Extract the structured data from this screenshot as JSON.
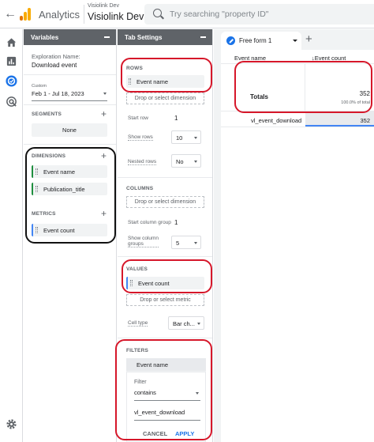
{
  "topbar": {
    "product": "Analytics",
    "account_small": "Visiolink Dev",
    "account_name": "Visiolink Dev",
    "search_placeholder": "Try searching \"property ID\""
  },
  "leftnav": {
    "icons": [
      "home-icon",
      "reports-icon",
      "explore-icon",
      "advertising-icon",
      "settings-icon"
    ]
  },
  "variables": {
    "title": "Variables",
    "exploration_label": "Exploration Name:",
    "exploration_name": "Download event",
    "date_custom": "Custom",
    "date_range": "Feb 1 - Jul 18, 2023",
    "segments_label": "SEGMENTS",
    "segments_none": "None",
    "dimensions_label": "DIMENSIONS",
    "dimensions": [
      "Event name",
      "Publication_title"
    ],
    "metrics_label": "METRICS",
    "metrics": [
      "Event count"
    ]
  },
  "tab_settings": {
    "title": "Tab Settings",
    "rows_label": "ROWS",
    "rows_chip": "Event name",
    "drop_dimension": "Drop or select dimension",
    "start_row_label": "Start row",
    "start_row": "1",
    "show_rows_label": "Show rows",
    "show_rows": "10",
    "nested_rows_label": "Nested rows",
    "nested_rows": "No",
    "columns_label": "COLUMNS",
    "start_col_group_label": "Start column group",
    "start_col_group": "1",
    "show_col_groups_label_1": "Show column",
    "show_col_groups_label_2": "groups",
    "show_col_groups": "5",
    "values_label": "VALUES",
    "values_chip": "Event count",
    "drop_metric": "Drop or select metric",
    "cell_type_label": "Cell type",
    "cell_type": "Bar ch...",
    "filters_label": "FILTERS",
    "filter_chip": "Event name",
    "filter_label": "Filter",
    "filter_match": "contains",
    "filter_value": "vl_event_download",
    "cancel": "CANCEL",
    "apply": "APPLY"
  },
  "canvas": {
    "tab_name": "Free form 1",
    "col_dimension": "Event name",
    "col_metric": "↓Event count",
    "totals_label": "Totals",
    "totals_value": "352",
    "totals_pct": "100.0% of total",
    "row_label": "vl_event_download",
    "row_value": "352"
  },
  "colors": {
    "accent": "#1a73e8",
    "panel_header": "#5f6368",
    "annotation_red": "#d6172a",
    "annotation_black": "#111111"
  }
}
